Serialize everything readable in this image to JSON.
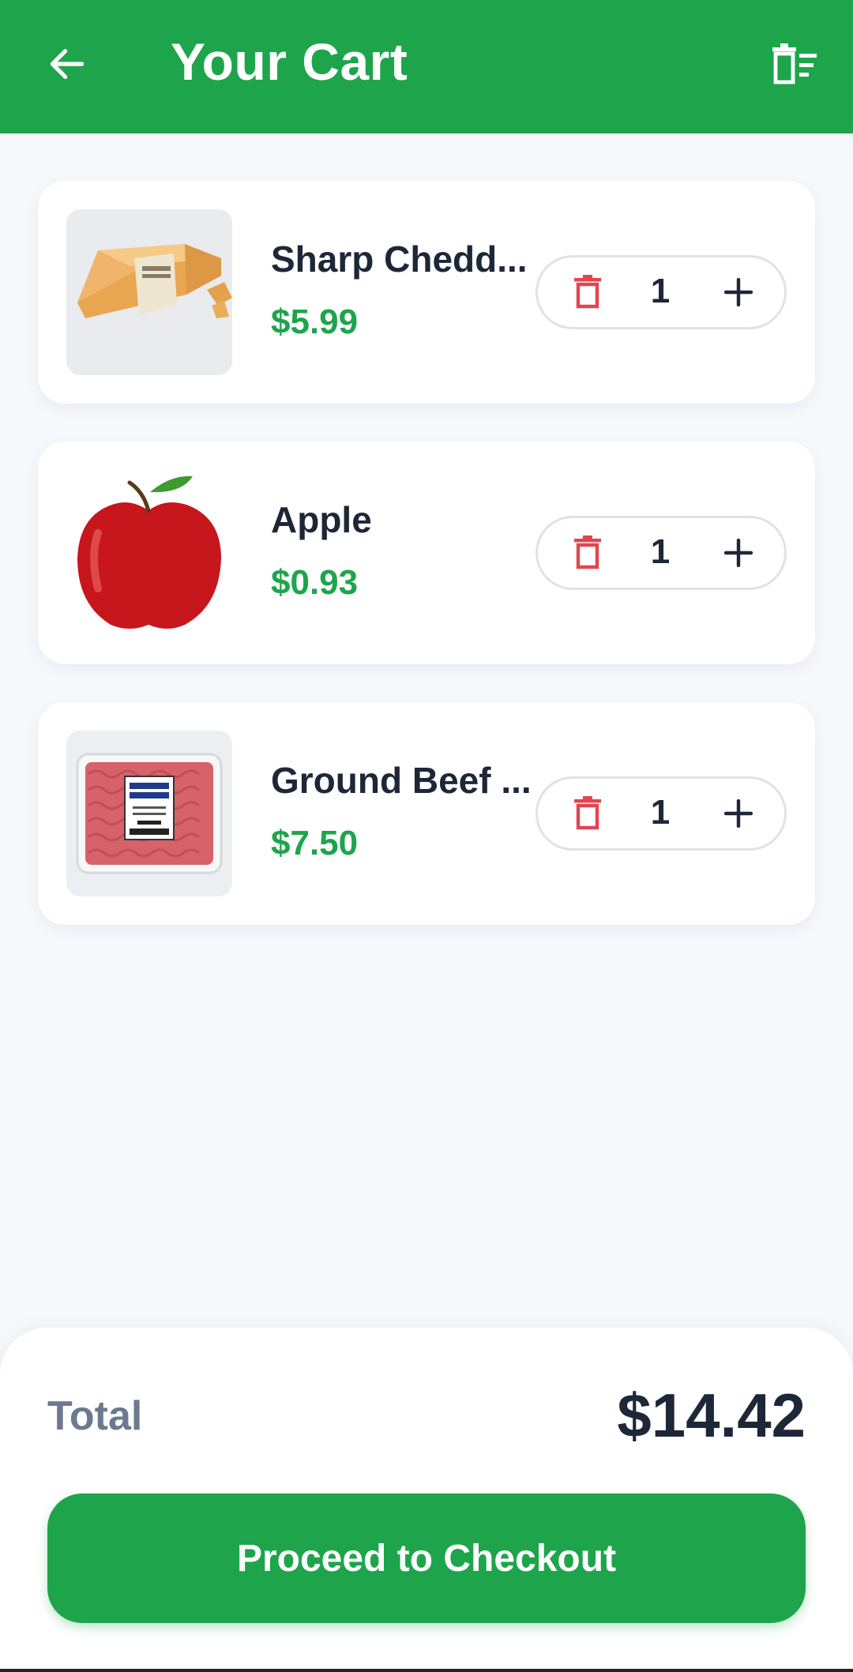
{
  "header": {
    "title": "Your Cart",
    "back_icon": "arrow-left-icon",
    "clear_icon": "clear-cart-icon"
  },
  "colors": {
    "brand": "#1ea54c",
    "price": "#1ea54c",
    "delete": "#e2454f",
    "text": "#1d2738"
  },
  "items": [
    {
      "name": "Sharp Chedd...",
      "price": "$5.99",
      "quantity": "1",
      "image": "sharp-cheddar-image"
    },
    {
      "name": "Apple",
      "price": "$0.93",
      "quantity": "1",
      "image": "apple-image"
    },
    {
      "name": "Ground Beef ...",
      "price": "$7.50",
      "quantity": "1",
      "image": "ground-beef-image"
    }
  ],
  "footer": {
    "total_label": "Total",
    "total_value": "$14.42",
    "checkout_label": "Proceed to Checkout"
  }
}
